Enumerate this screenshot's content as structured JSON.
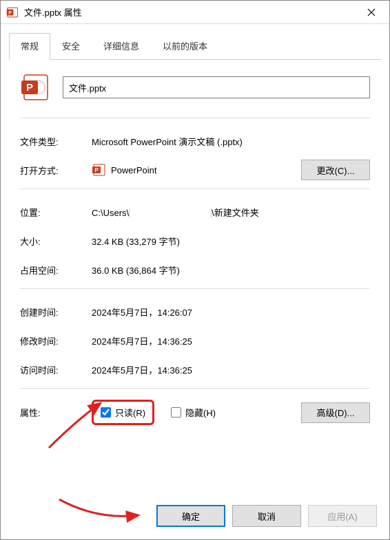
{
  "window": {
    "title": "文件.pptx 属性"
  },
  "tabs": {
    "general": "常规",
    "security": "安全",
    "details": "详细信息",
    "previous": "以前的版本"
  },
  "file": {
    "name": "文件.pptx"
  },
  "labels": {
    "file_type": "文件类型:",
    "opens_with": "打开方式:",
    "location": "位置:",
    "size": "大小:",
    "size_on_disk": "占用空间:",
    "created": "创建时间:",
    "modified": "修改时间:",
    "accessed": "访问时间:",
    "attributes": "属性:"
  },
  "values": {
    "file_type": "Microsoft PowerPoint 演示文稿 (.pptx)",
    "opens_with_app": "PowerPoint",
    "location_prefix": "C:\\Users\\",
    "location_suffix": "\\新建文件夹",
    "size": "32.4 KB (33,279 字节)",
    "size_on_disk": "36.0 KB (36,864 字节)",
    "created": "2024年5月7日，14:26:07",
    "modified": "2024年5月7日，14:36:25",
    "accessed": "2024年5月7日，14:36:25"
  },
  "buttons": {
    "change": "更改(C)...",
    "advanced": "高级(D)...",
    "ok": "确定",
    "cancel": "取消",
    "apply": "应用(A)"
  },
  "checkboxes": {
    "readonly": "只读(R)",
    "hidden": "隐藏(H)"
  },
  "colors": {
    "annotation": "#e02020",
    "primary_border": "#0078d7"
  }
}
